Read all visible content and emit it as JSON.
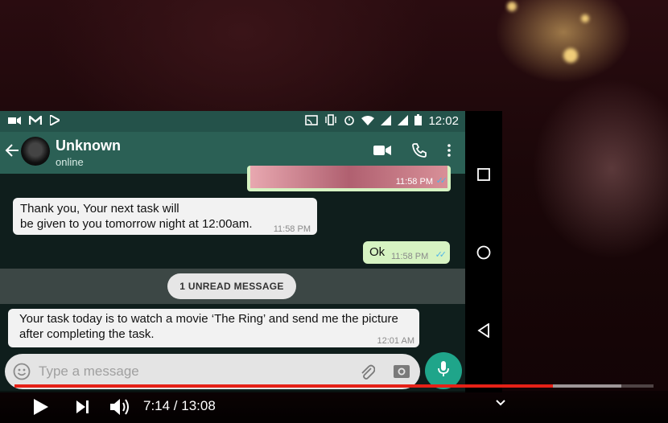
{
  "status_bar": {
    "time": "12:02"
  },
  "chat_header": {
    "contact_name": "Unknown",
    "contact_status": "online"
  },
  "messages": [
    {
      "direction": "outgoing",
      "kind": "image",
      "time": "11:58 PM",
      "ticks": "✓✓"
    },
    {
      "direction": "incoming",
      "kind": "text",
      "text_line1": "Thank you, Your next task will",
      "text_line2": "be given to you tomorrow night at 12:00am.",
      "time": "11:58 PM"
    },
    {
      "direction": "outgoing",
      "kind": "text",
      "text": "Ok",
      "time": "11:58 PM",
      "ticks": "✓✓"
    },
    {
      "direction": "incoming",
      "kind": "text",
      "text_line1": "Your task today is to watch a movie ‘The Ring’ and send me the picture",
      "text_line2": "after completing the task.",
      "time": "12:01 AM"
    }
  ],
  "unread_banner": "1 UNREAD MESSAGE",
  "composer": {
    "placeholder": "Type a message"
  },
  "player": {
    "time_display": "7:14 / 13:08",
    "progress_played": 0.842,
    "progress_buffered": 0.95
  },
  "colors": {
    "whatsapp_header": "#2b6055",
    "whatsapp_status": "#24524a",
    "mic_button": "#1fa58a",
    "progress_red": "#e62117",
    "tick_blue": "#4fb5e8"
  },
  "icons": [
    "video-camera-icon",
    "phone-icon",
    "more-vertical-icon",
    "back-arrow-icon",
    "emoji-icon",
    "attach-icon",
    "camera-icon",
    "mic-icon",
    "recents-icon",
    "home-icon",
    "back-nav-icon",
    "play-icon",
    "next-icon",
    "volume-icon",
    "chevron-down-icon"
  ]
}
